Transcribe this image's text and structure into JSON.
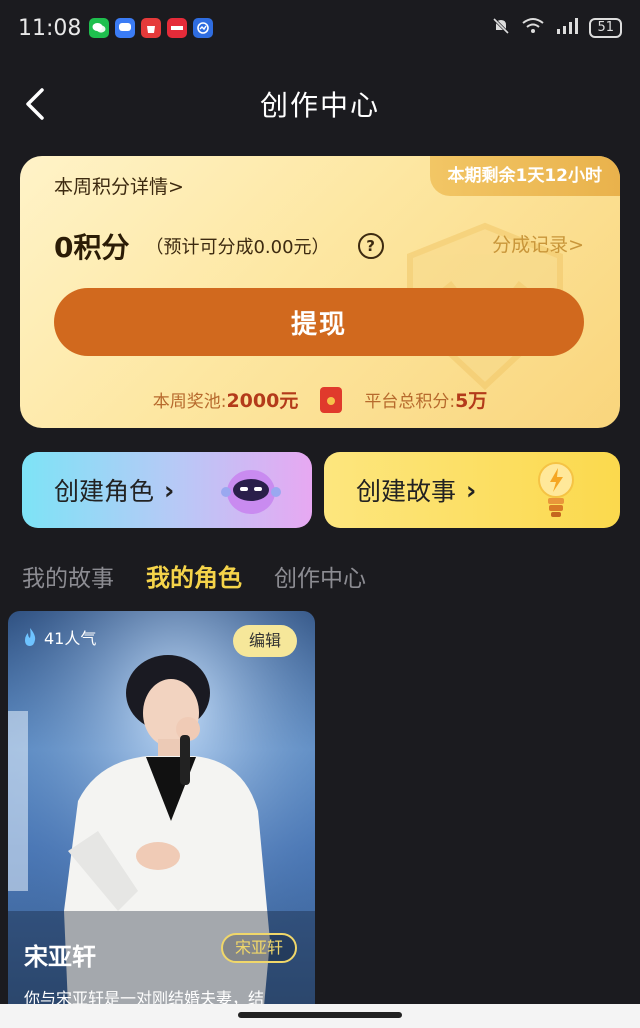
{
  "status_bar": {
    "time": "11:08",
    "battery": "51",
    "apps": [
      {
        "name": "wechat-icon",
        "color": "#1fbf4e",
        "label": ""
      },
      {
        "name": "message-icon",
        "color": "#3b7cf5",
        "label": ""
      },
      {
        "name": "appgallery-icon",
        "color": "#e53a3a",
        "label": "App Gallery"
      },
      {
        "name": "shop-icon",
        "color": "#e52b39",
        "label": "中国移动"
      },
      {
        "name": "monitor-icon",
        "color": "#2f6de0",
        "label": ""
      }
    ]
  },
  "nav": {
    "title": "创作中心"
  },
  "points_card": {
    "week_detail": "本周积分详情>",
    "period_remaining": "本期剩余1天12小时",
    "points": "0积分",
    "estimate": "（预计可分成0.00元）",
    "help": "?",
    "records": "分成记录>",
    "withdraw": "提现",
    "pool_label": "本周奖池:",
    "pool_value": "2000元",
    "total_label": "平台总积分:",
    "total_value": "5万"
  },
  "create": {
    "role": "创建角色",
    "story": "创建故事"
  },
  "tabs": [
    "我的故事",
    "我的角色",
    "创作中心"
  ],
  "active_tab": 1,
  "role_card": {
    "heat": "41人气",
    "edit": "编辑",
    "name": "宋亚轩",
    "tag": "宋亚轩",
    "desc": "你与宋亚轩是一对刚结婚夫妻，结"
  },
  "colors": {
    "accent": "#f5d44a",
    "withdraw": "#d1691e"
  }
}
